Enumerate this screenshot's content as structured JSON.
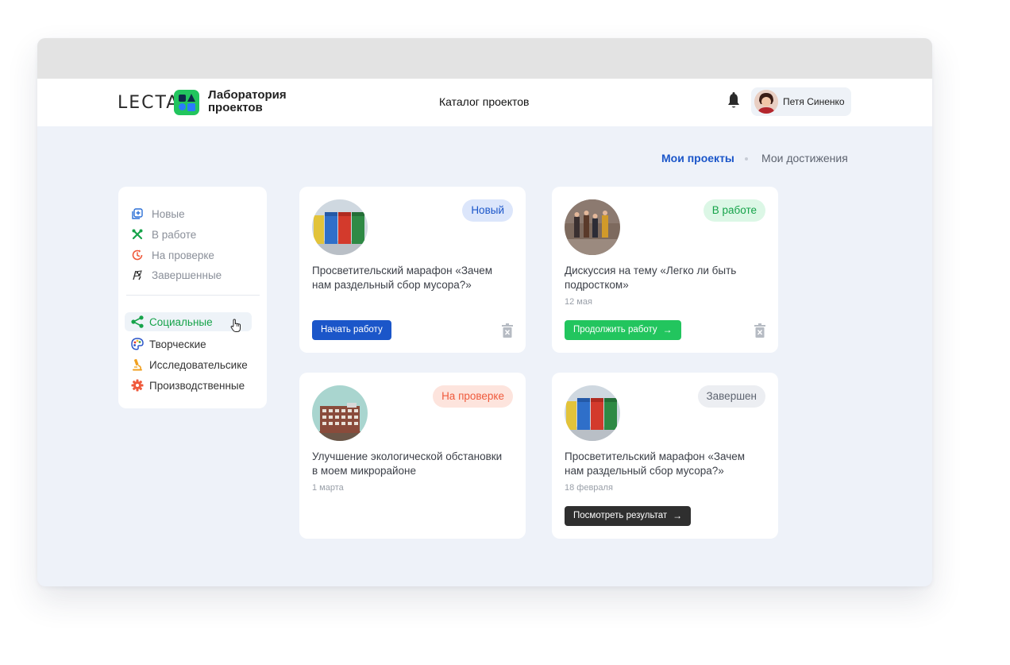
{
  "brand": {
    "word": "LECTA",
    "name_line1": "Лаборатория",
    "name_line2": "проектов"
  },
  "header": {
    "title": "Каталог проектов",
    "user_name": "Петя Синенко"
  },
  "tabs": {
    "active": "Мои проекты",
    "inactive": "Мои достижения"
  },
  "sidebar": {
    "statuses": [
      {
        "label": "Новые",
        "icon": "plus-square-icon",
        "color": "#2b6fd6"
      },
      {
        "label": "В работе",
        "icon": "tools-icon",
        "color": "#16a34a"
      },
      {
        "label": "На проверке",
        "icon": "clock-icon",
        "color": "#ef5a3c"
      },
      {
        "label": "Завершенные",
        "icon": "finish-flag-icon",
        "color": "#333333"
      }
    ],
    "categories": [
      {
        "label": "Социальные",
        "icon": "share-icon",
        "color": "#16a34a",
        "active": true
      },
      {
        "label": "Творческие",
        "icon": "palette-icon",
        "color": "#2b56c9",
        "active": false
      },
      {
        "label": "Исследовательсике",
        "icon": "microscope-icon",
        "color": "#f0a020",
        "active": false
      },
      {
        "label": "Производственные",
        "icon": "gear-icon",
        "color": "#ef5a3c",
        "active": false
      }
    ]
  },
  "cards": [
    {
      "badge": "Новый",
      "badge_bg": "#dce6fb",
      "badge_color": "#1b56c9",
      "title": "Просветительский марафон «Зачем нам раздельный сбор мусора?»",
      "date": "",
      "button": "Начать работу",
      "button_bg": "#1b56c9",
      "arrow": "",
      "trash": true
    },
    {
      "badge": "В работе",
      "badge_bg": "#dcf7e6",
      "badge_color": "#16a34a",
      "title": "Дискуссия на тему «Легко ли быть подростком»",
      "date": "12 мая",
      "button": "Продолжить работу",
      "button_bg": "#22c55e",
      "arrow": "→",
      "trash": true
    },
    {
      "badge": "На проверке",
      "badge_bg": "#fde4dd",
      "badge_color": "#ef5a3c",
      "title": "Улучшение экологической обстановки в моем микрорайоне",
      "date": "1 марта",
      "button": "",
      "button_bg": "",
      "arrow": "",
      "trash": false
    },
    {
      "badge": "Завершен",
      "badge_bg": "#eceef2",
      "badge_color": "#5e6470",
      "title": "Просветительский марафон «Зачем нам раздельный сбор мусора?»",
      "date": "18 февраля",
      "button": "Посмотреть результат",
      "button_bg": "#2f2f2f",
      "arrow": "→",
      "trash": false
    }
  ]
}
